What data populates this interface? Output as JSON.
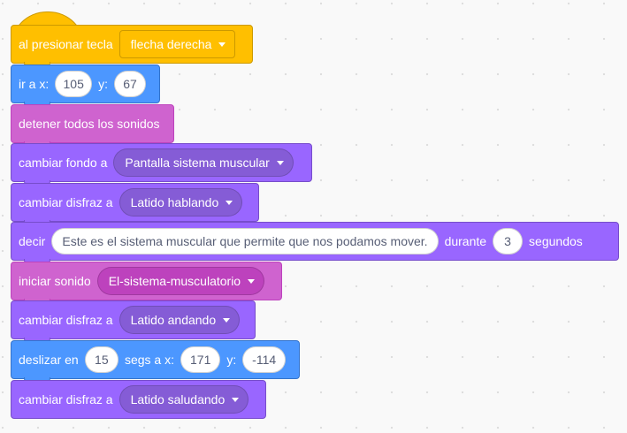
{
  "blocks": {
    "hat": {
      "label": "al presionar tecla",
      "key": "flecha derecha"
    },
    "goto": {
      "label": "ir a x:",
      "x": "105",
      "y_label": "y:",
      "y": "67"
    },
    "stop_sounds": {
      "label": "detener todos los sonidos"
    },
    "backdrop": {
      "label": "cambiar fondo a",
      "value": "Pantalla sistema muscular"
    },
    "costume1": {
      "label": "cambiar disfraz a",
      "value": "Latido hablando"
    },
    "say": {
      "label": "decir",
      "message": "Este es el sistema muscular que permite que nos podamos mover.",
      "during": "durante",
      "secs": "3",
      "unit": "segundos"
    },
    "play_sound": {
      "label": "iniciar sonido",
      "value": "El-sistema-musculatorio"
    },
    "costume2": {
      "label": "cambiar disfraz a",
      "value": "Latido andando"
    },
    "glide": {
      "label": "deslizar en",
      "secs": "15",
      "secs_label": "segs a x:",
      "x": "171",
      "y_label": "y:",
      "y": "-114"
    },
    "costume3": {
      "label": "cambiar disfraz a",
      "value": "Latido saludando"
    }
  },
  "colors": {
    "events": "#ffbf00",
    "motion": "#4c97ff",
    "sound": "#cf63cf",
    "looks": "#9966ff",
    "workspace": "#f9f9f9"
  }
}
